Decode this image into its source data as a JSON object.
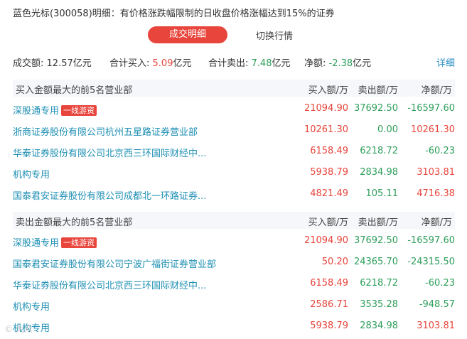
{
  "title": "蓝色光标(300058)明细：有价格涨跌幅限制的日收盘价格涨幅达到15%的证券",
  "tabs": {
    "active": "成交明细",
    "other": "切换行情"
  },
  "summary": {
    "turnover_label": "成交额:",
    "turnover_value": "12.57亿元",
    "buy_label": "合计买入:",
    "buy_value": "5.09",
    "buy_unit": "亿元",
    "sell_label": "合计卖出:",
    "sell_value": "7.48",
    "sell_unit": "亿元",
    "net_label": "净额:",
    "net_value": "-2.38",
    "net_unit": "亿元",
    "detail_link": "详细"
  },
  "buy_section": {
    "header": "买入金额最大的前5名营业部",
    "col_buy": "买入额/万",
    "col_sell": "卖出额/万",
    "col_net": "净额/万",
    "rows": [
      {
        "name": "深股通专用",
        "badge": "一线游资",
        "buy": "21094.90",
        "sell": "37692.50",
        "net": "-16597.60"
      },
      {
        "name": "浙商证券股份有限公司杭州五星路证券营业部",
        "badge": "",
        "buy": "10261.30",
        "sell": "0.00",
        "net": "10261.30"
      },
      {
        "name": "华泰证券股份有限公司北京西三环国际财经中...",
        "badge": "",
        "buy": "6158.49",
        "sell": "6218.72",
        "net": "-60.23"
      },
      {
        "name": "机构专用",
        "badge": "",
        "buy": "5938.79",
        "sell": "2834.98",
        "net": "3103.81"
      },
      {
        "name": "国泰君安证券股份有限公司成都北一环路证券...",
        "badge": "",
        "buy": "4821.49",
        "sell": "105.11",
        "net": "4716.38"
      }
    ]
  },
  "sell_section": {
    "header": "卖出金额最大的前5名营业部",
    "col_buy": "买入额/万",
    "col_sell": "卖出额/万",
    "col_net": "净额/万",
    "rows": [
      {
        "name": "深股通专用",
        "badge": "一线游资",
        "buy": "21094.90",
        "sell": "37692.50",
        "net": "-16597.60"
      },
      {
        "name": "国泰君安证券股份有限公司宁波广福街证券营业部",
        "badge": "",
        "buy": "50.20",
        "sell": "24365.70",
        "net": "-24315.50"
      },
      {
        "name": "华泰证券股份有限公司北京西三环国际财经中...",
        "badge": "",
        "buy": "6158.49",
        "sell": "6218.72",
        "net": "-60.23"
      },
      {
        "name": "机构专用",
        "badge": "",
        "buy": "2586.71",
        "sell": "3535.28",
        "net": "-948.57"
      },
      {
        "name": "机构专用",
        "badge": "",
        "buy": "5938.79",
        "sell": "2834.98",
        "net": "3103.81"
      }
    ]
  },
  "colors": {
    "red": "#e8453c",
    "green": "#2e9e5b",
    "blue": "#1e8fb3"
  }
}
